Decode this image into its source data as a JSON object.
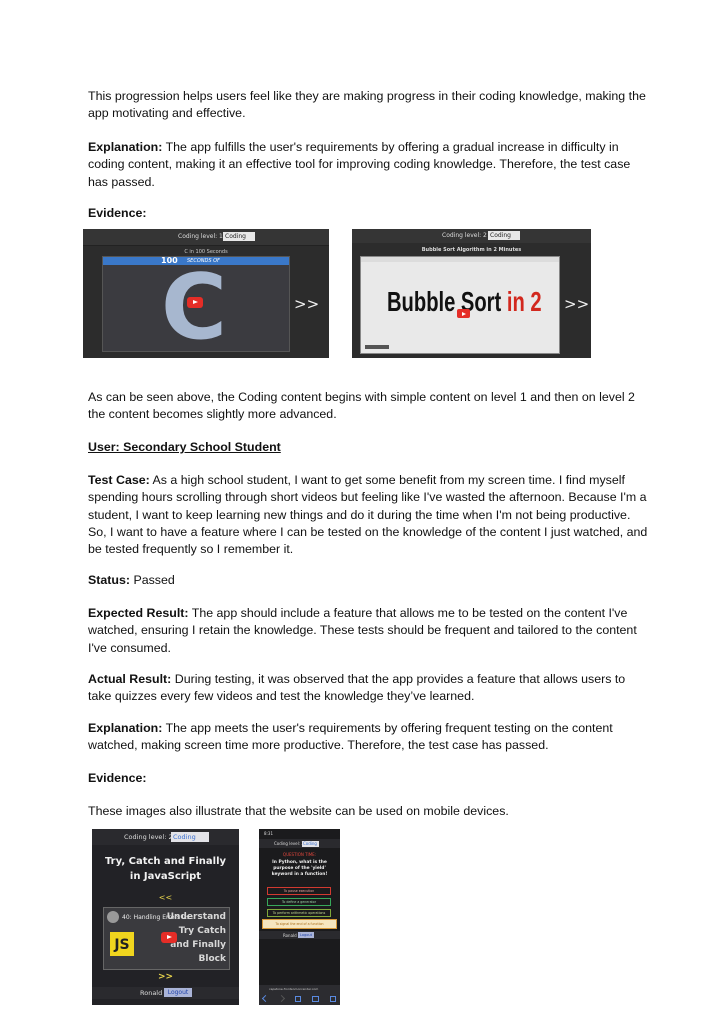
{
  "p1": "This progression helps users feel like they are making progress in their coding knowledge, making the app motivating and effective.",
  "p2": {
    "label": "Explanation:",
    "text": " The app fulfills the user's requirements by offering a gradual increase in difficulty in coding content, making it an effective tool for improving coding knowledge. Therefore, the test case has passed."
  },
  "evidence1": "Evidence:",
  "shot1": {
    "level_label": "Coding level: 1",
    "category": "Coding",
    "video_title": "C in 100 Seconds",
    "banner_number": "100",
    "banner_text": "SECONDS OF",
    "big_letter": "C",
    "arrow": ">>"
  },
  "shot2": {
    "level_label": "Coding level: 2",
    "category": "Coding",
    "video_title": "Bubble Sort Algorithm in 2 Minutes",
    "thumb_black": "Bubble Sort",
    "thumb_red": "in 2",
    "arrow": ">>"
  },
  "p3": "As can be seen above, the Coding content begins with simple content on level 1 and then on level 2 the content becomes slightly more advanced.",
  "user_heading": "User: Secondary School Student",
  "test_case": {
    "label": "Test Case:",
    "text": " As a high school student, I want to get some benefit from my screen time. I find myself spending hours scrolling through short videos but feeling like I've wasted the afternoon. Because I'm a student, I want to keep learning new things and do it during the time when I'm not being productive. So, I want to have a feature where I can be tested on the knowledge of the content I just watched, and be tested frequently so I remember it."
  },
  "status": {
    "label": "Status:",
    "text": " Passed"
  },
  "expected": {
    "label": "Expected Result:",
    "text": " The app should include a feature that allows me to be tested on the content I've watched, ensuring I retain the knowledge. These tests should be frequent and tailored to the content I've consumed."
  },
  "actual": {
    "label": "Actual Result:",
    "text": " During testing, it was observed that the app provides a feature that allows users to take quizzes every few videos and test the knowledge they’ve learned."
  },
  "explanation2": {
    "label": "Explanation:",
    "text": " The app meets the user's requirements by offering frequent testing on the content watched, making screen time more productive. Therefore, the test case has passed."
  },
  "evidence2": "Evidence:",
  "p_mobile": "These images also illustrate that the website can be used on mobile devices.",
  "shot3": {
    "level_label": "Coding level: 2",
    "category": "Coding",
    "title_line1": "Try, Catch and Finally",
    "title_line2": "in JavaScript",
    "prev": "<<",
    "video_title": "40: Handling Errors Us...",
    "thumb_line1": "Understand",
    "thumb_line2": "Try Catch",
    "thumb_line3": "and Finally",
    "thumb_line4": "Block",
    "js_badge": "JS",
    "next": ">>",
    "user": "Ronald",
    "logout": "Logout"
  },
  "shot4": {
    "time": "8:31",
    "level_label": "Coding level: 3",
    "category": "Coding",
    "question_header": "QUESTION TIME:",
    "question": "In Python, what is the purpose of the 'yield' keyword in a function!",
    "options": [
      "To pause execution",
      "To define a generator",
      "To perform arithmetic operations",
      "To signal the end of a function"
    ],
    "user": "Ronald",
    "logout": "Logout",
    "url": "capstone-frontend.onrender.com"
  }
}
